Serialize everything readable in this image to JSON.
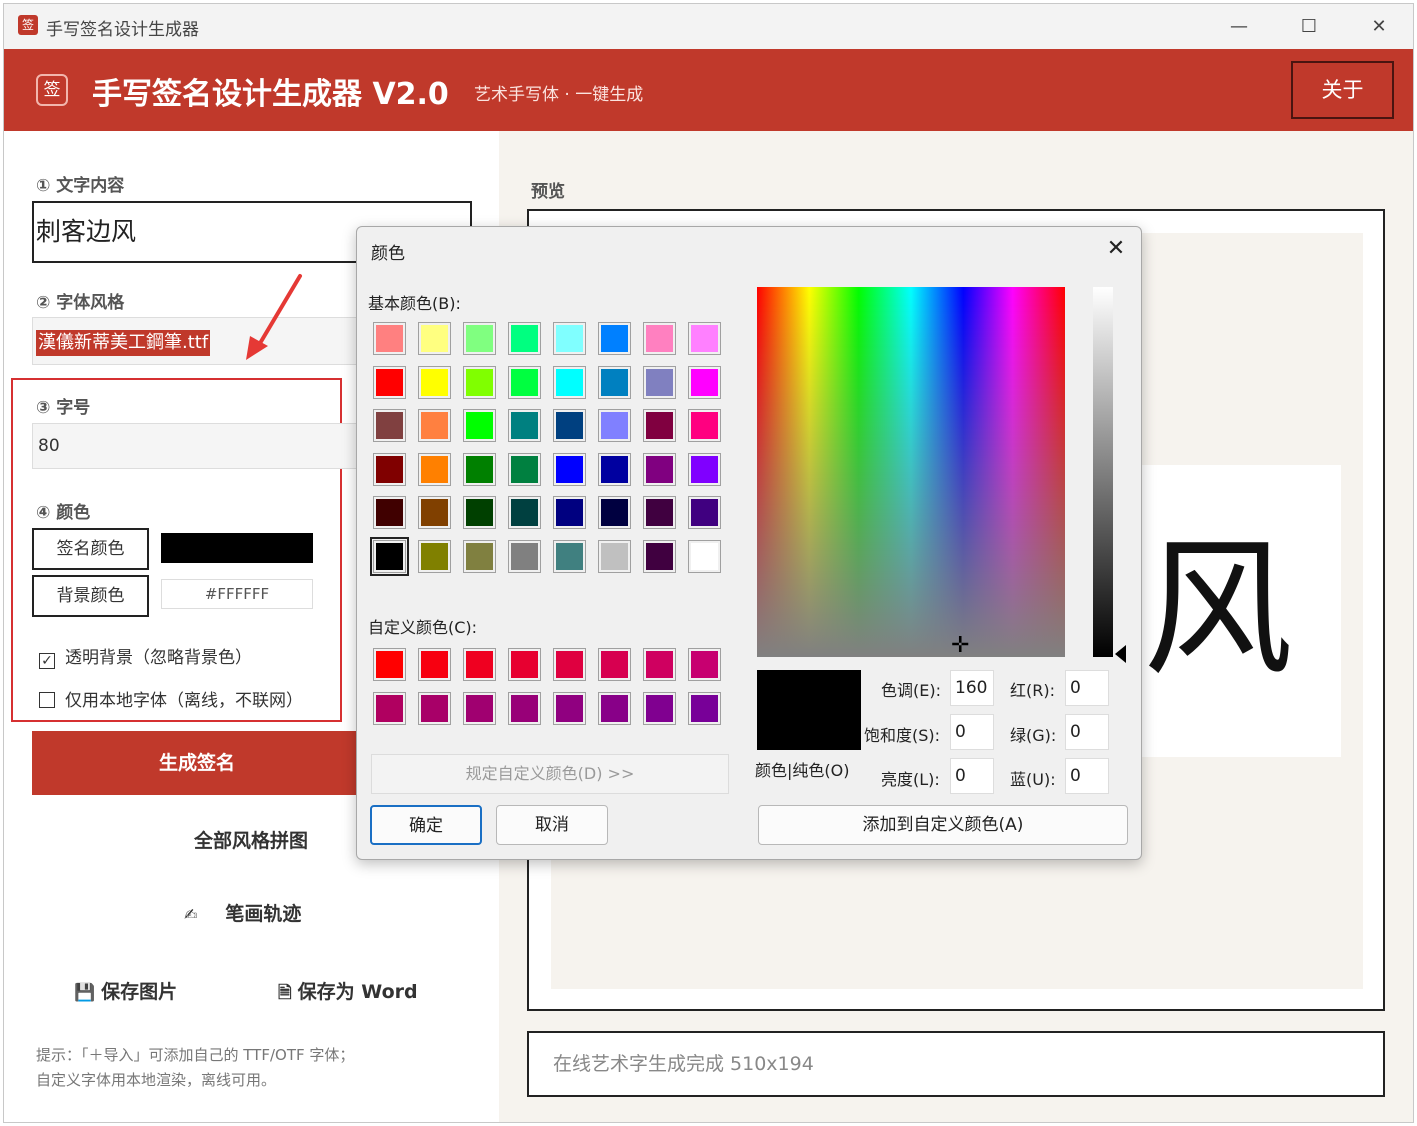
{
  "window": {
    "app_icon": "签",
    "title": "手写签名设计生成器",
    "minimize": "—",
    "maximize": "☐",
    "close": "✕"
  },
  "header": {
    "logo": "签",
    "title": "手写签名设计生成器  V2.0",
    "subtitle": "艺术手写体 · 一键生成",
    "about_label": "关于"
  },
  "left": {
    "text_label": "① 文字内容",
    "text_value": "刺客边风",
    "font_label": "② 字体风格",
    "font_value": "漢儀新蒂美工鋼筆.ttf",
    "size_label": "③ 字号",
    "size_value": "80",
    "color_label": "④ 颜色",
    "sign_color_btn": "签名颜色",
    "bg_color_btn": "背景颜色",
    "bg_hex": "#FFFFFF",
    "transparent_label": "透明背景（忽略背景色）",
    "transparent_checked": "✓",
    "local_font_label": "仅用本地字体（离线，不联网）",
    "generate_btn": "生成签名",
    "all_styles_btn": "全部风格拼图",
    "stroke_icon": "✍",
    "stroke_btn": "笔画轨迹",
    "save_img_icon": "💾",
    "save_img_btn": "保存图片",
    "save_word_icon": "🗎",
    "save_word_btn": "保存为 Word",
    "hint_line1": "提示：「＋导入」可添加自己的 TTF/OTF 字体；",
    "hint_line2": "自定义字体用本地渲染，离线可用。"
  },
  "right": {
    "preview_label": "预览",
    "preview_char": "风",
    "status": "在线艺术字生成完成 510x194"
  },
  "dialog": {
    "title": "颜色",
    "close": "✕",
    "basic_label": "基本颜色(B):",
    "custom_label": "自定义颜色(C):",
    "define_btn": "规定自定义颜色(D) >>",
    "ok_btn": "确定",
    "cancel_btn": "取消",
    "color_solid_label": "颜色|纯色(O)",
    "hue_label": "色调(E):",
    "hue_value": "160",
    "sat_label": "饱和度(S):",
    "sat_value": "0",
    "lum_label": "亮度(L):",
    "lum_value": "0",
    "red_label": "红(R):",
    "red_value": "0",
    "green_label": "绿(G):",
    "green_value": "0",
    "blue_label": "蓝(U):",
    "blue_value": "0",
    "add_custom_btn": "添加到自定义颜色(A)",
    "basic_colors": [
      [
        "#ff8080",
        "#ffff80",
        "#80ff80",
        "#00ff80",
        "#80ffff",
        "#0080ff",
        "#ff80c0",
        "#ff80ff"
      ],
      [
        "#ff0000",
        "#ffff00",
        "#80ff00",
        "#00ff40",
        "#00ffff",
        "#0080c0",
        "#8080c0",
        "#ff00ff"
      ],
      [
        "#804040",
        "#ff8040",
        "#00ff00",
        "#008080",
        "#004080",
        "#8080ff",
        "#800040",
        "#ff0080"
      ],
      [
        "#800000",
        "#ff8000",
        "#008000",
        "#008040",
        "#0000ff",
        "#0000a0",
        "#800080",
        "#8000ff"
      ],
      [
        "#400000",
        "#804000",
        "#004000",
        "#004040",
        "#000080",
        "#000040",
        "#400040",
        "#400080"
      ],
      [
        "#000000",
        "#808000",
        "#808040",
        "#808080",
        "#408080",
        "#c0c0c0",
        "#400040",
        "#ffffff"
      ]
    ],
    "custom_colors": [
      [
        "#ff0000",
        "#f70010",
        "#ef0020",
        "#e70030",
        "#df0040",
        "#d70050",
        "#cf0060",
        "#c70070"
      ],
      [
        "#b00060",
        "#a80068",
        "#a00070",
        "#980078",
        "#900080",
        "#880088",
        "#800090",
        "#780098"
      ]
    ]
  }
}
